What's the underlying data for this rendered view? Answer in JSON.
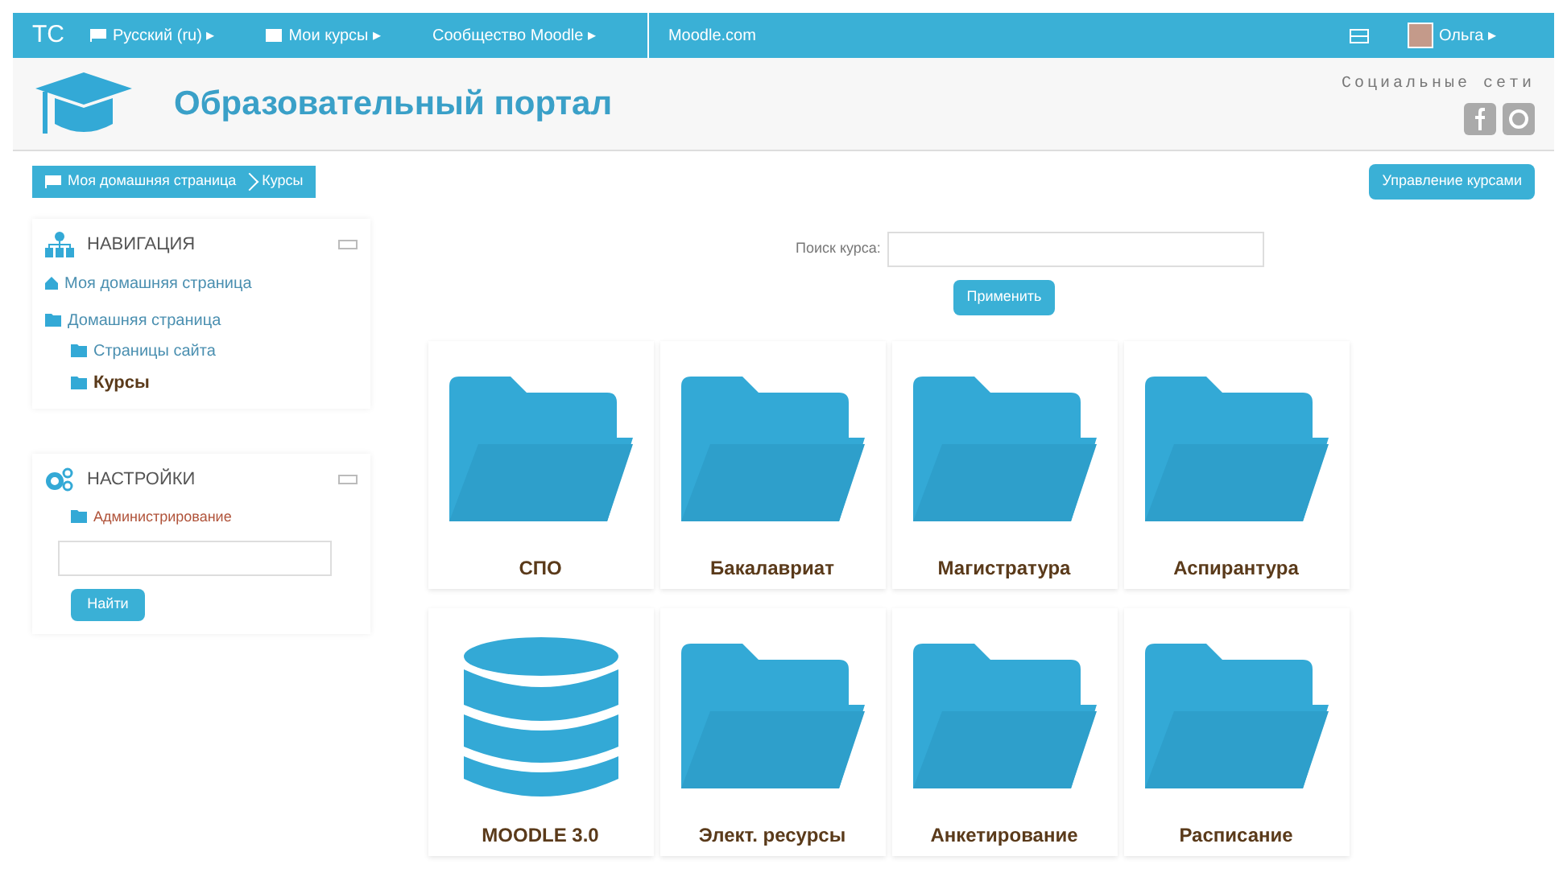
{
  "top_bar": {
    "logo": "TC",
    "menus": [
      {
        "kind": "flag",
        "label": "Русский (ru) ▸"
      },
      {
        "kind": "mail",
        "label": "Мои курсы ▸"
      },
      {
        "kind": "plain",
        "label": "Сообщество Moodle ▸"
      }
    ],
    "link": "Moodle.com",
    "user": "Ольга ▸"
  },
  "header": {
    "title": "Образовательный портал",
    "social_title": "Социальные сети"
  },
  "breadcrumb": [
    "Моя домашняя страница",
    "Курсы"
  ],
  "manage_button": "Управление курсами",
  "navigation": {
    "title": "НАВИГАЦИЯ",
    "items": [
      {
        "kind": "home",
        "label": "Моя домашняя страница",
        "selected": false
      },
      {
        "kind": "folder",
        "label": "Домашняя страница",
        "selected": false,
        "children": [
          {
            "kind": "folder",
            "label": "Страницы сайта",
            "selected": false
          },
          {
            "kind": "folder",
            "label": "Курсы",
            "selected": true
          }
        ]
      }
    ]
  },
  "settings": {
    "title": "НАСТРОЙКИ",
    "items": [
      {
        "label": "Администрирование"
      }
    ],
    "search_button": "Найти"
  },
  "course_search": {
    "label": "Поиск курса:",
    "button": "Применить"
  },
  "categories": [
    {
      "kind": "folder",
      "label": "СПО"
    },
    {
      "kind": "folder",
      "label": "Бакалавриат"
    },
    {
      "kind": "folder",
      "label": "Магистратура"
    },
    {
      "kind": "folder",
      "label": "Аспирантура"
    },
    {
      "kind": "database",
      "label": "MOODLE 3.0"
    },
    {
      "kind": "folder",
      "label": "Элект. ресурсы"
    },
    {
      "kind": "folder",
      "label": "Анкетирование"
    },
    {
      "kind": "folder",
      "label": "Расписание"
    }
  ]
}
